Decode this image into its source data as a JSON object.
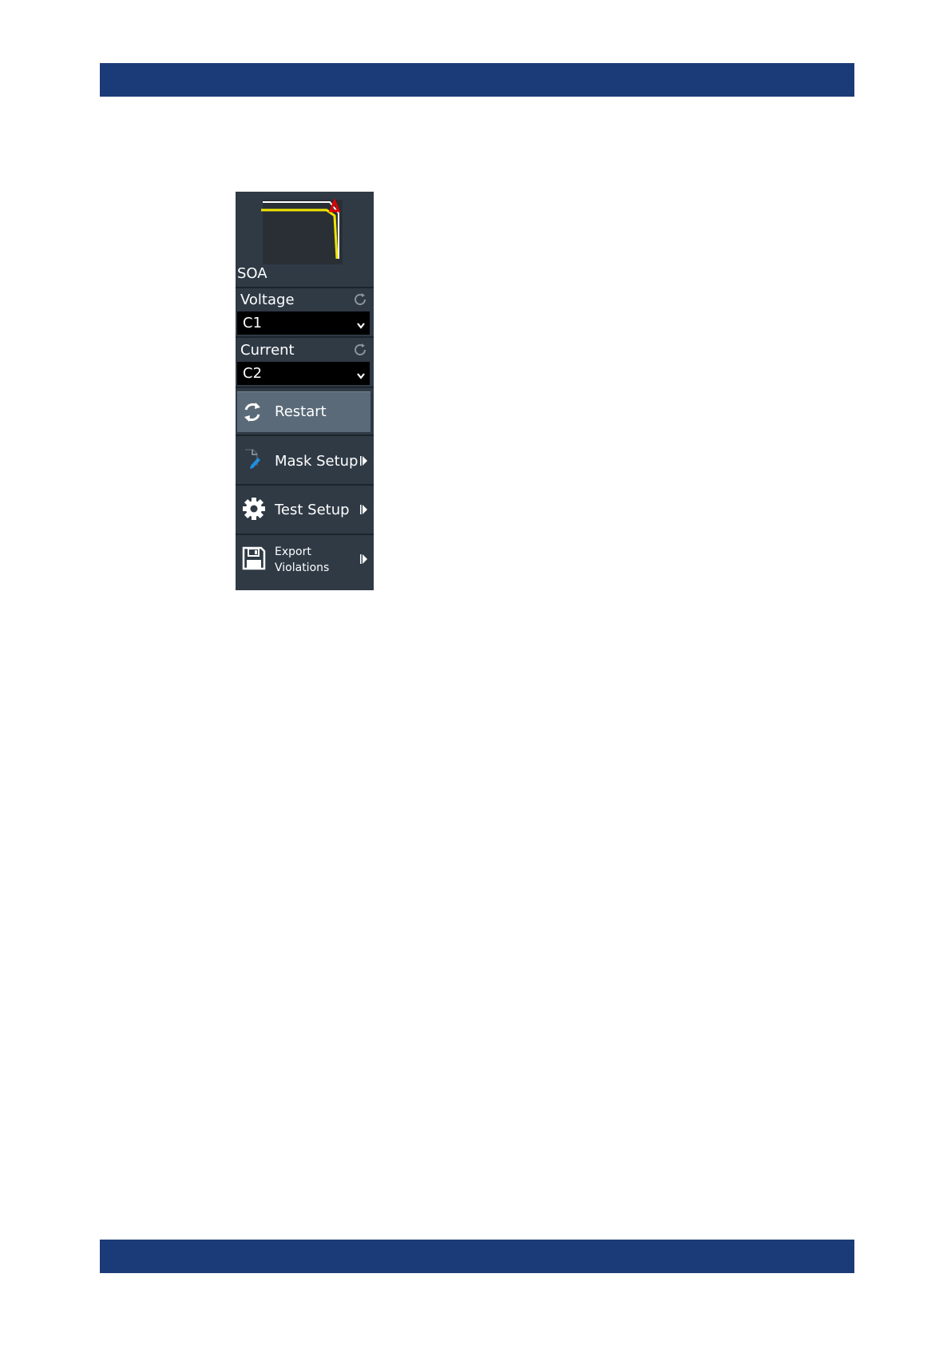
{
  "panel": {
    "preview_label": "SOA",
    "voltage": {
      "label": "Voltage",
      "value": "C1"
    },
    "current": {
      "label": "Current",
      "value": "C2"
    },
    "buttons": {
      "restart": "Restart",
      "mask_setup": "Mask Setup",
      "test_setup": "Test Setup",
      "export_line1": "Export",
      "export_line2": "Violations"
    },
    "icons": {
      "reset": "reset-icon",
      "dropdown": "chevron-down-icon",
      "restart": "refresh-icon",
      "mask": "mask-edit-icon",
      "test": "gear-icon",
      "export": "floppy-disk-icon",
      "submenu": "submenu-arrow-icon"
    },
    "colors": {
      "band": "#1b3a78",
      "panel": "#2f3a45",
      "restart_active": "#5a6a78",
      "trace": "#f0e600",
      "violation": "#e00000",
      "mask_line": "#ffffff"
    }
  }
}
